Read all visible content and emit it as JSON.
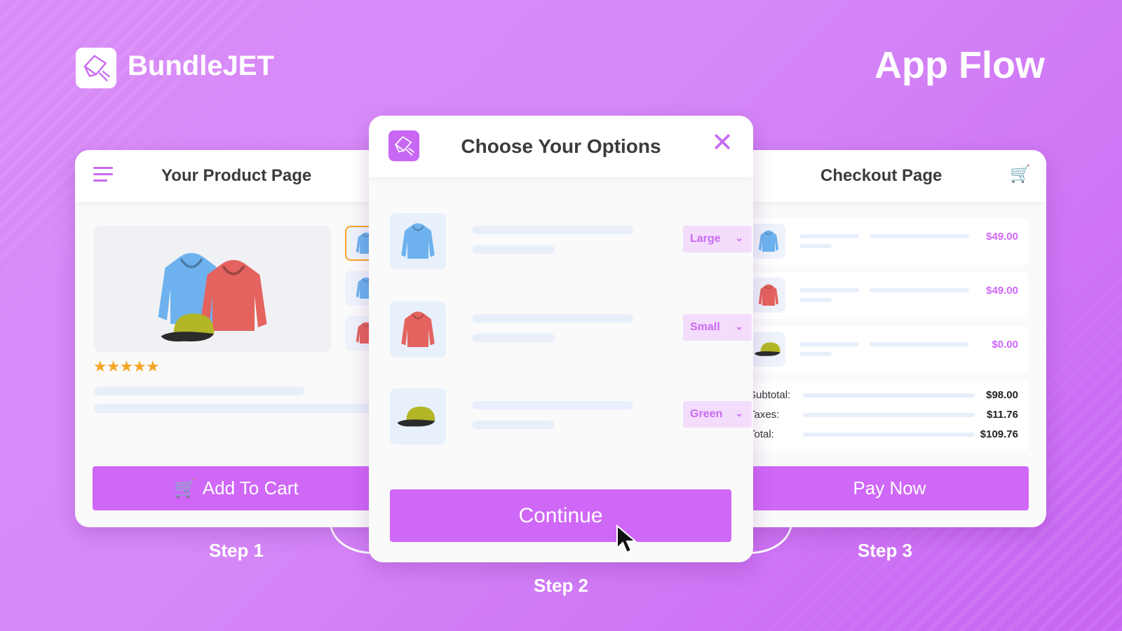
{
  "brand": {
    "name": "BundleJET",
    "heading": "App Flow"
  },
  "colors": {
    "accent": "#cf67f7",
    "background": "#d98bf7",
    "star": "#f5a623"
  },
  "step1": {
    "title": "Your Product Page",
    "menu_icon": "hamburger-icon",
    "rating": 5,
    "rating_max": 5,
    "button": "Add To Cart",
    "step_label": "Step 1"
  },
  "step2": {
    "title": "Choose Your Options",
    "continue": "Continue",
    "step_label": "Step 2",
    "options": [
      {
        "product": "blue hoodie",
        "selected": "Large"
      },
      {
        "product": "red hoodie",
        "selected": "Small"
      },
      {
        "product": "green cap",
        "selected": "Green"
      }
    ]
  },
  "step3": {
    "title": "Checkout Page",
    "cart_icon": "cart-icon",
    "items": [
      {
        "product": "blue hoodie",
        "price": "$49.00"
      },
      {
        "product": "red hoodie",
        "price": "$49.00"
      },
      {
        "product": "green cap",
        "price": "$0.00"
      }
    ],
    "summary": [
      {
        "label": "Subtotal:",
        "value": "$98.00"
      },
      {
        "label": "Taxes:",
        "value": "$11.76"
      },
      {
        "label": "Total:",
        "value": "$109.76"
      }
    ],
    "button": "Pay Now",
    "step_label": "Step 3"
  }
}
